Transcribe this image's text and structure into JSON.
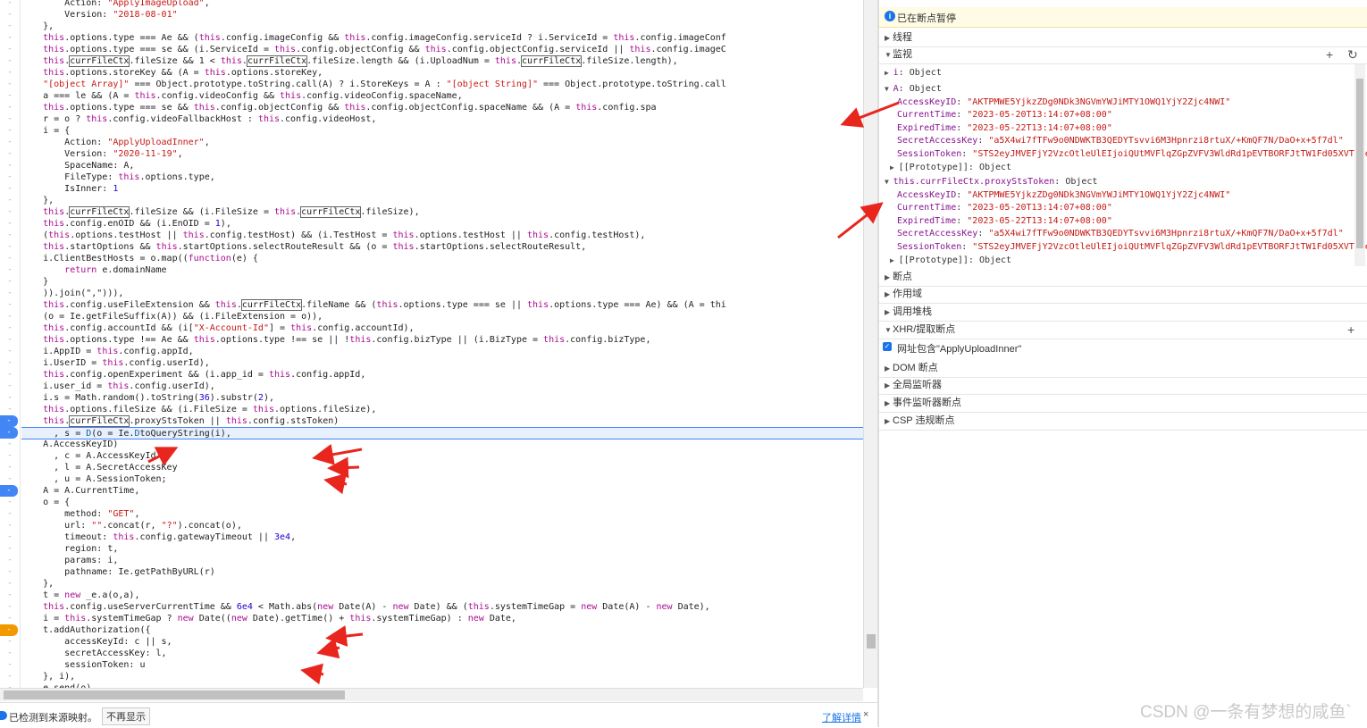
{
  "code": {
    "lines": [
      [
        {
          "t": "        Action: "
        },
        {
          "c": "s",
          "t": "\"ApplyImageUpload\""
        },
        {
          "t": ","
        }
      ],
      [
        {
          "t": "        Version: "
        },
        {
          "c": "s",
          "t": "\"2018-08-01\""
        }
      ],
      [
        {
          "t": "    },"
        }
      ],
      [
        {
          "t": "    "
        },
        {
          "c": "k",
          "t": "this"
        },
        {
          "t": ".options.type === Ae && ("
        },
        {
          "c": "k",
          "t": "this"
        },
        {
          "t": ".config.imageConfig && "
        },
        {
          "c": "k",
          "t": "this"
        },
        {
          "t": ".config.imageConfig.serviceId ? i.ServiceId = "
        },
        {
          "c": "k",
          "t": "this"
        },
        {
          "t": ".config.imageConf"
        }
      ],
      [
        {
          "t": "    "
        },
        {
          "c": "k",
          "t": "this"
        },
        {
          "t": ".options.type === se && (i.ServiceId = "
        },
        {
          "c": "k",
          "t": "this"
        },
        {
          "t": ".config.objectConfig && "
        },
        {
          "c": "k",
          "t": "this"
        },
        {
          "t": ".config.objectConfig.serviceId || "
        },
        {
          "c": "k",
          "t": "this"
        },
        {
          "t": ".config.imageC"
        }
      ],
      [
        {
          "t": "    "
        },
        {
          "c": "k",
          "t": "this"
        },
        {
          "t": "."
        },
        {
          "c": "hl",
          "t": "currFileCtx"
        },
        {
          "t": ".fileSize && 1 < "
        },
        {
          "c": "k",
          "t": "this"
        },
        {
          "t": "."
        },
        {
          "c": "hl",
          "t": "currFileCtx"
        },
        {
          "t": ".fileSize.length && (i.UploadNum = "
        },
        {
          "c": "k",
          "t": "this"
        },
        {
          "t": "."
        },
        {
          "c": "hl",
          "t": "currFileCtx"
        },
        {
          "t": ".fileSize.length),"
        }
      ],
      [
        {
          "t": "    "
        },
        {
          "c": "k",
          "t": "this"
        },
        {
          "t": ".options.storeKey && (A = "
        },
        {
          "c": "k",
          "t": "this"
        },
        {
          "t": ".options.storeKey,"
        }
      ],
      [
        {
          "t": "    "
        },
        {
          "c": "s",
          "t": "\"[object Array]\""
        },
        {
          "t": " === Object.prototype.toString.call(A) ? i.StoreKeys = A : "
        },
        {
          "c": "s",
          "t": "\"[object String]\""
        },
        {
          "t": " === Object.prototype.toString.call"
        }
      ],
      [
        {
          "t": "    a === le && (A = "
        },
        {
          "c": "k",
          "t": "this"
        },
        {
          "t": ".config.videoConfig && "
        },
        {
          "c": "k",
          "t": "this"
        },
        {
          "t": ".config.videoConfig.spaceName,"
        }
      ],
      [
        {
          "t": "    "
        },
        {
          "c": "k",
          "t": "this"
        },
        {
          "t": ".options.type === se && "
        },
        {
          "c": "k",
          "t": "this"
        },
        {
          "t": ".config.objectConfig && "
        },
        {
          "c": "k",
          "t": "this"
        },
        {
          "t": ".config.objectConfig.spaceName && (A = "
        },
        {
          "c": "k",
          "t": "this"
        },
        {
          "t": ".config.spa"
        }
      ],
      [
        {
          "t": "    r = o ? "
        },
        {
          "c": "k",
          "t": "this"
        },
        {
          "t": ".config.videoFallbackHost : "
        },
        {
          "c": "k",
          "t": "this"
        },
        {
          "t": ".config.videoHost,"
        }
      ],
      [
        {
          "t": "    i = {"
        }
      ],
      [
        {
          "t": "        Action: "
        },
        {
          "c": "s",
          "t": "\"ApplyUploadInner\""
        },
        {
          "t": ","
        }
      ],
      [
        {
          "t": "        Version: "
        },
        {
          "c": "s",
          "t": "\"2020-11-19\""
        },
        {
          "t": ","
        }
      ],
      [
        {
          "t": "        SpaceName: A,"
        }
      ],
      [
        {
          "t": "        FileType: "
        },
        {
          "c": "k",
          "t": "this"
        },
        {
          "t": ".options.type,"
        }
      ],
      [
        {
          "t": "        IsInner: "
        },
        {
          "c": "n",
          "t": "1"
        }
      ],
      [
        {
          "t": "    },"
        }
      ],
      [
        {
          "t": "    "
        },
        {
          "c": "k",
          "t": "this"
        },
        {
          "t": "."
        },
        {
          "c": "hl",
          "t": "currFileCtx"
        },
        {
          "t": ".fileSize && (i.FileSize = "
        },
        {
          "c": "k",
          "t": "this"
        },
        {
          "t": "."
        },
        {
          "c": "hl",
          "t": "currFileCtx"
        },
        {
          "t": ".fileSize),"
        }
      ],
      [
        {
          "t": "    "
        },
        {
          "c": "k",
          "t": "this"
        },
        {
          "t": ".config.enOID && (i.EnOID = "
        },
        {
          "c": "n",
          "t": "1"
        },
        {
          "t": "),"
        }
      ],
      [
        {
          "t": "    ("
        },
        {
          "c": "k",
          "t": "this"
        },
        {
          "t": ".options.testHost || "
        },
        {
          "c": "k",
          "t": "this"
        },
        {
          "t": ".config.testHost) && (i.TestHost = "
        },
        {
          "c": "k",
          "t": "this"
        },
        {
          "t": ".options.testHost || "
        },
        {
          "c": "k",
          "t": "this"
        },
        {
          "t": ".config.testHost),"
        }
      ],
      [
        {
          "t": "    "
        },
        {
          "c": "k",
          "t": "this"
        },
        {
          "t": ".startOptions && "
        },
        {
          "c": "k",
          "t": "this"
        },
        {
          "t": ".startOptions.selectRouteResult && (o = "
        },
        {
          "c": "k",
          "t": "this"
        },
        {
          "t": ".startOptions.selectRouteResult,"
        }
      ],
      [
        {
          "t": "    i.ClientBestHosts = o.map(("
        },
        {
          "c": "k",
          "t": "function"
        },
        {
          "t": "(e) {"
        }
      ],
      [
        {
          "t": "        "
        },
        {
          "c": "k",
          "t": "return"
        },
        {
          "t": " e.domainName"
        }
      ],
      [
        {
          "t": "    }"
        }
      ],
      [
        {
          "t": "    )).join(\",\"))),"
        }
      ],
      [
        {
          "t": "    "
        },
        {
          "c": "k",
          "t": "this"
        },
        {
          "t": ".config.useFileExtension && "
        },
        {
          "c": "k",
          "t": "this"
        },
        {
          "t": "."
        },
        {
          "c": "hl",
          "t": "currFileCtx"
        },
        {
          "t": ".fileName && ("
        },
        {
          "c": "k",
          "t": "this"
        },
        {
          "t": ".options.type === se || "
        },
        {
          "c": "k",
          "t": "this"
        },
        {
          "t": ".options.type === Ae) && (A = thi"
        }
      ],
      [
        {
          "t": "    (o = Ie.getFileSuffix(A)) && (i.FileExtension = o)),"
        }
      ],
      [
        {
          "t": "    "
        },
        {
          "c": "k",
          "t": "this"
        },
        {
          "t": ".config.accountId && (i["
        },
        {
          "c": "s",
          "t": "\"X-Account-Id\""
        },
        {
          "t": "] = "
        },
        {
          "c": "k",
          "t": "this"
        },
        {
          "t": ".config.accountId),"
        }
      ],
      [
        {
          "t": "    "
        },
        {
          "c": "k",
          "t": "this"
        },
        {
          "t": ".options.type !== Ae && "
        },
        {
          "c": "k",
          "t": "this"
        },
        {
          "t": ".options.type !== se || !"
        },
        {
          "c": "k",
          "t": "this"
        },
        {
          "t": ".config.bizType || (i.BizType = "
        },
        {
          "c": "k",
          "t": "this"
        },
        {
          "t": ".config.bizType,"
        }
      ],
      [
        {
          "t": "    i.AppID = "
        },
        {
          "c": "k",
          "t": "this"
        },
        {
          "t": ".config.appId,"
        }
      ],
      [
        {
          "t": "    i.UserID = "
        },
        {
          "c": "k",
          "t": "this"
        },
        {
          "t": ".config.userId),"
        }
      ],
      [
        {
          "t": "    "
        },
        {
          "c": "k",
          "t": "this"
        },
        {
          "t": ".config.openExperiment && (i.app_id = "
        },
        {
          "c": "k",
          "t": "this"
        },
        {
          "t": ".config.appId,"
        }
      ],
      [
        {
          "t": "    i.user_id = "
        },
        {
          "c": "k",
          "t": "this"
        },
        {
          "t": ".config.userId),"
        }
      ],
      [
        {
          "t": "    i.s = Math.random().toString("
        },
        {
          "c": "n",
          "t": "36"
        },
        {
          "t": ").substr("
        },
        {
          "c": "n",
          "t": "2"
        },
        {
          "t": "),"
        }
      ],
      [
        {
          "t": "    "
        },
        {
          "c": "k",
          "t": "this"
        },
        {
          "t": ".options.fileSize && (i.FileSize = "
        },
        {
          "c": "k",
          "t": "this"
        },
        {
          "t": ".options.fileSize),"
        }
      ],
      [
        {
          "t": "    "
        },
        {
          "c": "k",
          "t": "this"
        },
        {
          "t": "."
        },
        {
          "c": "hl",
          "t": "currFileCtx"
        },
        {
          "t": ".proxyStsToken || "
        },
        {
          "c": "k",
          "t": "this"
        },
        {
          "t": ".config.stsToken)"
        }
      ],
      [
        {
          "t": "      , s = "
        },
        {
          "c": "t",
          "t": "D"
        },
        {
          "t": "(o = Ie."
        },
        {
          "c": "t",
          "t": "D"
        },
        {
          "t": "toQueryString(i),"
        }
      ],
      [
        {
          "t": "    A.AccessKeyID)"
        }
      ],
      [
        {
          "t": "      , c = A.AccessKeyId"
        }
      ],
      [
        {
          "t": "      , l = A.SecretAccessKey"
        }
      ],
      [
        {
          "t": "      , u = A.SessionToken;"
        }
      ],
      [
        {
          "t": "    A = A.CurrentTime,"
        }
      ],
      [
        {
          "t": "    o = {"
        }
      ],
      [
        {
          "t": "        method: "
        },
        {
          "c": "s",
          "t": "\"GET\""
        },
        {
          "t": ","
        }
      ],
      [
        {
          "t": "        url: "
        },
        {
          "c": "s",
          "t": "\"\""
        },
        {
          "t": ".concat(r, "
        },
        {
          "c": "s",
          "t": "\"?\""
        },
        {
          "t": ").concat(o),"
        }
      ],
      [
        {
          "t": "        timeout: "
        },
        {
          "c": "k",
          "t": "this"
        },
        {
          "t": ".config.gatewayTimeout || "
        },
        {
          "c": "n",
          "t": "3e4"
        },
        {
          "t": ","
        }
      ],
      [
        {
          "t": "        region: t,"
        }
      ],
      [
        {
          "t": "        params: i,"
        }
      ],
      [
        {
          "t": "        pathname: Ie.getPathByURL(r)"
        }
      ],
      [
        {
          "t": "    },"
        }
      ],
      [
        {
          "t": "    t = "
        },
        {
          "c": "k",
          "t": "new"
        },
        {
          "t": " _e.a(o,a),"
        }
      ],
      [
        {
          "t": "    "
        },
        {
          "c": "k",
          "t": "this"
        },
        {
          "t": ".config.useServerCurrentTime && "
        },
        {
          "c": "n",
          "t": "6e4"
        },
        {
          "t": " < Math.abs("
        },
        {
          "c": "k",
          "t": "new"
        },
        {
          "t": " Date(A) - "
        },
        {
          "c": "k",
          "t": "new"
        },
        {
          "t": " Date) && ("
        },
        {
          "c": "k",
          "t": "this"
        },
        {
          "t": ".systemTimeGap = "
        },
        {
          "c": "k",
          "t": "new"
        },
        {
          "t": " Date(A) - "
        },
        {
          "c": "k",
          "t": "new"
        },
        {
          "t": " Date),"
        }
      ],
      [
        {
          "t": "    i = "
        },
        {
          "c": "k",
          "t": "this"
        },
        {
          "t": ".systemTimeGap ? "
        },
        {
          "c": "k",
          "t": "new"
        },
        {
          "t": " Date(("
        },
        {
          "c": "k",
          "t": "new"
        },
        {
          "t": " Date).getTime() + "
        },
        {
          "c": "k",
          "t": "this"
        },
        {
          "t": ".systemTimeGap) : "
        },
        {
          "c": "k",
          "t": "new"
        },
        {
          "t": " Date,"
        }
      ],
      [
        {
          "t": "    t.addAuthorization({"
        }
      ],
      [
        {
          "t": "        accessKeyId: c || s,"
        }
      ],
      [
        {
          "t": "        secretAccessKey: l,"
        }
      ],
      [
        {
          "t": "        sessionToken: u"
        }
      ],
      [
        {
          "t": "    }, i),"
        }
      ],
      [
        {
          "t": "    e.send(o)"
        }
      ]
    ],
    "exec_line": 37,
    "bp_lines": [
      36,
      37,
      42
    ],
    "cond_bp_lines": [
      54
    ],
    "gutter_mark": "-"
  },
  "info_bar": {
    "message": "已检测到来源映射。",
    "dismiss_label": "不再显示",
    "learn_more_label": "了解详情",
    "close_label": "×"
  },
  "sidebar": {
    "paused_icon": "i",
    "paused_text": "已在断点暂停",
    "threads_label": "线程",
    "watch_label": "监视",
    "watch_add": "+",
    "watch_refresh": "↻",
    "watch": {
      "i_expr": "i",
      "i_type": "Object",
      "A_expr": "A",
      "A_type": "Object",
      "A_props": [
        {
          "k": "AccessKeyID",
          "v": "\"AKTPMWE5YjkzZDg0NDk3NGVmYWJiMTY1OWQ1YjY2Zjc4NWI\""
        },
        {
          "k": "CurrentTime",
          "v": "\"2023-05-20T13:14:07+08:00\""
        },
        {
          "k": "ExpiredTime",
          "v": "\"2023-05-22T13:14:07+08:00\""
        },
        {
          "k": "SecretAccessKey",
          "v": "\"a5X4wi7fTFw9o0NDWKTB3QEDYTsvvi6M3Hpnrzi8rtuX/+KmQF7N/DaO+x+5f7dl\""
        },
        {
          "k": "SessionToken",
          "v": "\"STS2eyJMVEFjY2VzcOtleUlEIjoiQUtMVFlqZGpZVFV3WldRd1pEVTBORFJtTW1Fd05XVTVOemR"
        }
      ],
      "proto_label": "[[Prototype]]: Object",
      "ctx_expr": "this.currFileCtx.proxyStsToken",
      "ctx_type": "Object",
      "ctx_props": [
        {
          "k": "AccessKeyID",
          "v": "\"AKTPMWE5YjkzZDg0NDk3NGVmYWJiMTY1OWQ1YjY2Zjc4NWI\""
        },
        {
          "k": "CurrentTime",
          "v": "\"2023-05-20T13:14:07+08:00\""
        },
        {
          "k": "ExpiredTime",
          "v": "\"2023-05-22T13:14:07+08:00\""
        },
        {
          "k": "SecretAccessKey",
          "v": "\"a5X4wi7fTFw9o0NDWKTB3QEDYTsvvi6M3Hpnrzi8rtuX/+KmQF7N/DaO+x+5f7dl\""
        },
        {
          "k": "SessionToken",
          "v": "\"STS2eyJMVEFjY2VzcOtleUlEIjoiQUtMVFlqZGpZVFV3WldRd1pEVTBORFJtTW1Fd05XVTVOemR"
        }
      ]
    },
    "breakpoints_label": "断点",
    "scope_label": "作用域",
    "callstack_label": "调用堆栈",
    "xhr_label": "XHR/提取断点",
    "xhr_add": "+",
    "xhr_item": "网址包含\"ApplyUploadInner\"",
    "dom_label": "DOM 断点",
    "global_label": "全局监听器",
    "event_label": "事件监听器断点",
    "csp_label": "CSP 违规断点"
  },
  "watermark": "CSDN @一条有梦想的咸鱼`",
  "colors": {
    "breakpoint": "#4285f4",
    "conditional_breakpoint": "#f29900",
    "arrow": "#e8261e",
    "paused_bg": "#fffbe5"
  }
}
